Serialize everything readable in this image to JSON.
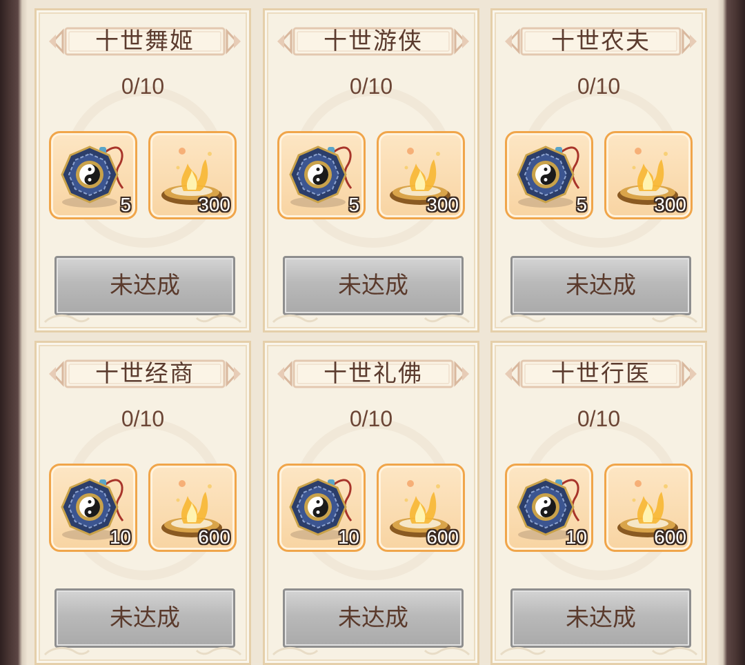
{
  "cards": [
    {
      "title": "十世舞姬",
      "progress": "0/10",
      "item1_qty": "5",
      "item2_qty": "300",
      "button": "未达成"
    },
    {
      "title": "十世游侠",
      "progress": "0/10",
      "item1_qty": "5",
      "item2_qty": "300",
      "button": "未达成"
    },
    {
      "title": "十世农夫",
      "progress": "0/10",
      "item1_qty": "5",
      "item2_qty": "300",
      "button": "未达成"
    },
    {
      "title": "十世经商",
      "progress": "0/10",
      "item1_qty": "10",
      "item2_qty": "600",
      "button": "未达成"
    },
    {
      "title": "十世礼佛",
      "progress": "0/10",
      "item1_qty": "10",
      "item2_qty": "600",
      "button": "未达成"
    },
    {
      "title": "十世行医",
      "progress": "0/10",
      "item1_qty": "10",
      "item2_qty": "600",
      "button": "未达成"
    }
  ],
  "icons": {
    "item1": "yin-yang-compass-icon",
    "item2": "flame-incense-icon"
  },
  "colors": {
    "item_border": "#f0a54a",
    "button_disabled": "#b9b9b9",
    "title_text": "#5b3b2e"
  }
}
